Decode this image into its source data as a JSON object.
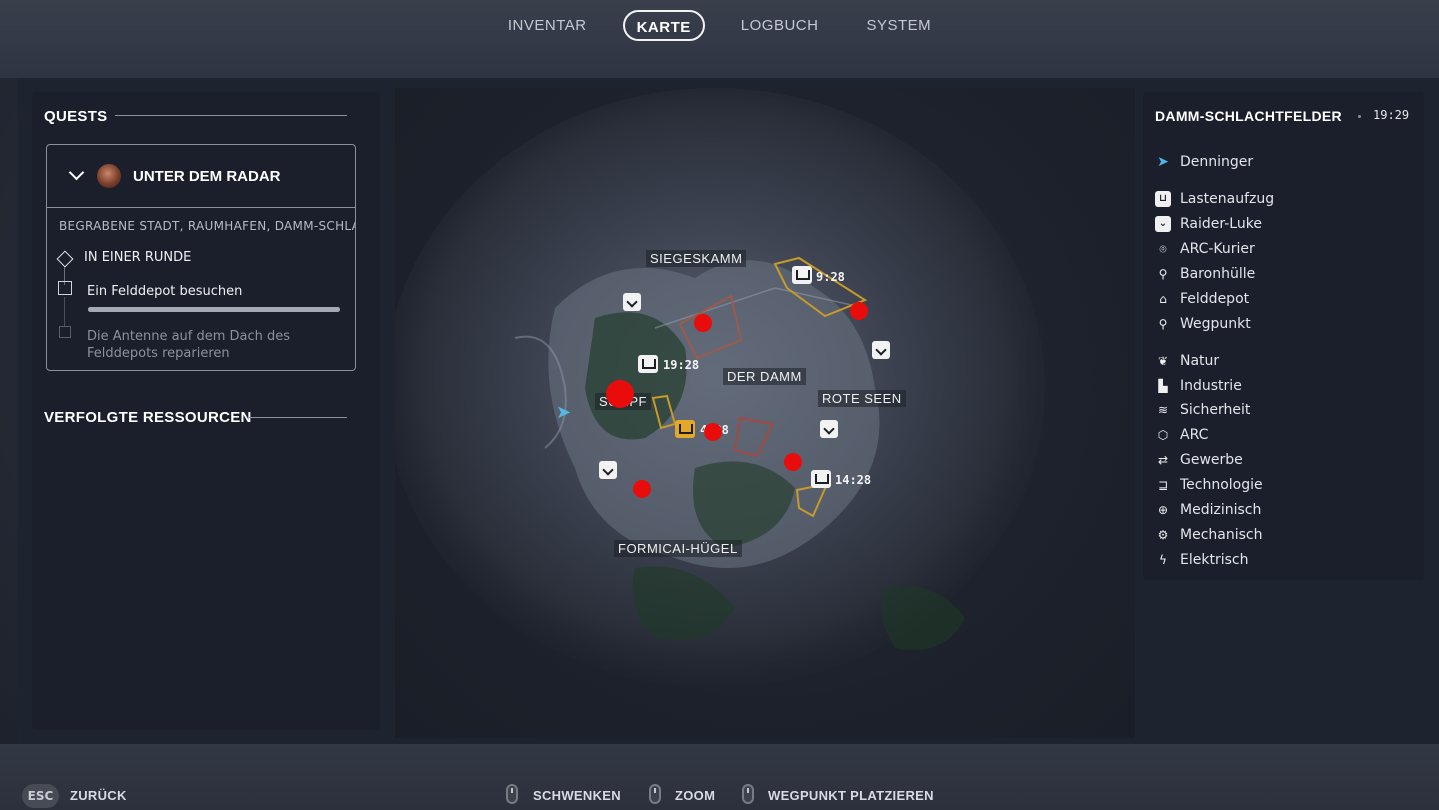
{
  "nav": {
    "tabs": [
      {
        "label": "INVENTAR",
        "active": false
      },
      {
        "label": "KARTE",
        "active": true
      },
      {
        "label": "LOGBUCH",
        "active": false
      },
      {
        "label": "SYSTEM",
        "active": false
      }
    ]
  },
  "quests": {
    "section_title": "QUESTS",
    "quest": {
      "name": "UNTER DEM RADAR",
      "locations": "BEGRABENE STADT, RAUMHAFEN, DAMM-SCHLACHTFELDER",
      "stage": "IN EINER RUNDE",
      "objectives": [
        {
          "text": "Ein Felddepot besuchen",
          "progress": 0,
          "active": true
        },
        {
          "text": "Die Antenne auf dem Dach des Felddepots reparieren",
          "active": false
        }
      ]
    },
    "tracked_title": "VERFOLGTE RESSOURCEN"
  },
  "map": {
    "labels": {
      "siegeskamm": "SIEGESKAMM",
      "der_damm": "DER DAMM",
      "rote_seen": "ROTE SEEN",
      "sumpf": "SUMPF",
      "formicai": "FORMICAI-HÜGEL"
    },
    "timers": {
      "t1": "9:28",
      "t2": "19:28",
      "t3": "4:28",
      "t4": "14:28"
    }
  },
  "legend": {
    "title": "DAMM-SCHLACHTFELDER",
    "time": "19:29",
    "player": {
      "icon": "player-arrow-icon",
      "label": "Denninger"
    },
    "points": [
      {
        "icon": "cargo-lift-icon",
        "label": "Lastenaufzug"
      },
      {
        "icon": "raider-hatch-icon",
        "label": "Raider-Luke"
      },
      {
        "icon": "arc-courier-icon",
        "label": "ARC-Kurier"
      },
      {
        "icon": "baron-husk-icon",
        "label": "Baronhülle"
      },
      {
        "icon": "field-depot-icon",
        "label": "Felddepot"
      },
      {
        "icon": "waypoint-icon",
        "label": "Wegpunkt"
      }
    ],
    "categories": [
      {
        "icon": "nature-icon",
        "label": "Natur"
      },
      {
        "icon": "industry-icon",
        "label": "Industrie"
      },
      {
        "icon": "security-icon",
        "label": "Sicherheit"
      },
      {
        "icon": "arc-icon",
        "label": "ARC"
      },
      {
        "icon": "commerce-icon",
        "label": "Gewerbe"
      },
      {
        "icon": "technology-icon",
        "label": "Technologie"
      },
      {
        "icon": "medical-icon",
        "label": "Medizinisch"
      },
      {
        "icon": "mechanical-icon",
        "label": "Mechanisch"
      },
      {
        "icon": "electrical-icon",
        "label": "Elektrisch"
      }
    ]
  },
  "footer": {
    "esc_key": "ESC",
    "back": "ZURÜCK",
    "pan": "SCHWENKEN",
    "zoom": "ZOOM",
    "place_waypoint": "WEGPUNKT PLATZIEREN"
  },
  "colors": {
    "accent_red": "#e80c0c",
    "player_blue": "#56b8e6",
    "gold": "#e3a829"
  }
}
